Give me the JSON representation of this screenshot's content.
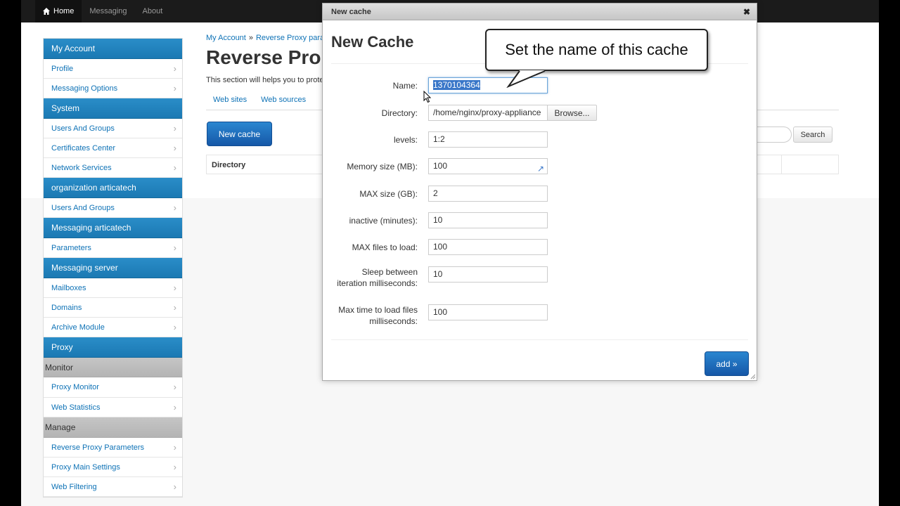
{
  "topnav": {
    "items": [
      {
        "label": "Home",
        "icon": "home-icon"
      },
      {
        "label": "Messaging"
      },
      {
        "label": "About"
      }
    ]
  },
  "leftmenu": {
    "sections": [
      {
        "header": "My Account",
        "items": [
          "Profile",
          "Messaging Options"
        ]
      },
      {
        "header": "System",
        "items": [
          "Users And Groups",
          "Certificates Center",
          "Network Services"
        ]
      },
      {
        "header": "organization articatech",
        "items": [
          "Users And Groups"
        ]
      },
      {
        "header": "Messaging articatech",
        "items": [
          "Parameters"
        ]
      },
      {
        "header": "Messaging server",
        "items": [
          "Mailboxes",
          "Domains",
          "Archive Module"
        ]
      },
      {
        "header": "Proxy",
        "items": []
      },
      {
        "header": "Monitor",
        "items": [
          "Proxy Monitor",
          "Web Statistics"
        ]
      },
      {
        "header": "Manage",
        "items": [
          "Reverse Proxy Parameters",
          "Proxy Main Settings",
          "Web Filtering"
        ]
      }
    ]
  },
  "main": {
    "breadcrumb": [
      "My Account",
      "Reverse Proxy para"
    ],
    "title": "Reverse Pro",
    "description": "This section will helps you to prote",
    "tabs": [
      "Web sites",
      "Web sources"
    ],
    "new_cache_label": "New cache",
    "table_header": "Directory",
    "search_label": "Search"
  },
  "modal": {
    "window_title": "New cache",
    "close_label": "✖",
    "heading": "New Cache",
    "fields": {
      "name": {
        "label": "Name:",
        "value": "1370104364"
      },
      "directory": {
        "label": "Directory:",
        "value": "/home/nginx/proxy-appliance"
      },
      "levels": {
        "label": "levels:",
        "value": "1:2"
      },
      "memory": {
        "label": "Memory size (MB):",
        "value": "100"
      },
      "maxsize": {
        "label": "MAX size (GB):",
        "value": "2"
      },
      "inactive": {
        "label": "inactive (minutes):",
        "value": "10"
      },
      "maxfiles": {
        "label": "MAX files to load:",
        "value": "100"
      },
      "sleep": {
        "label_line1": "Sleep between",
        "label_line2": "iteration milliseconds:",
        "value": "10"
      },
      "maxtime": {
        "label_line1": "Max time to load files",
        "label_line2": "milliseconds:",
        "value": "100"
      }
    },
    "browse_label": "Browse...",
    "add_label": "add »"
  },
  "callout": {
    "text": "Set the name of this cache"
  },
  "colors": {
    "accent": "#1b79b3",
    "link": "#0e72b6",
    "topnav": "#1b1b1b"
  }
}
